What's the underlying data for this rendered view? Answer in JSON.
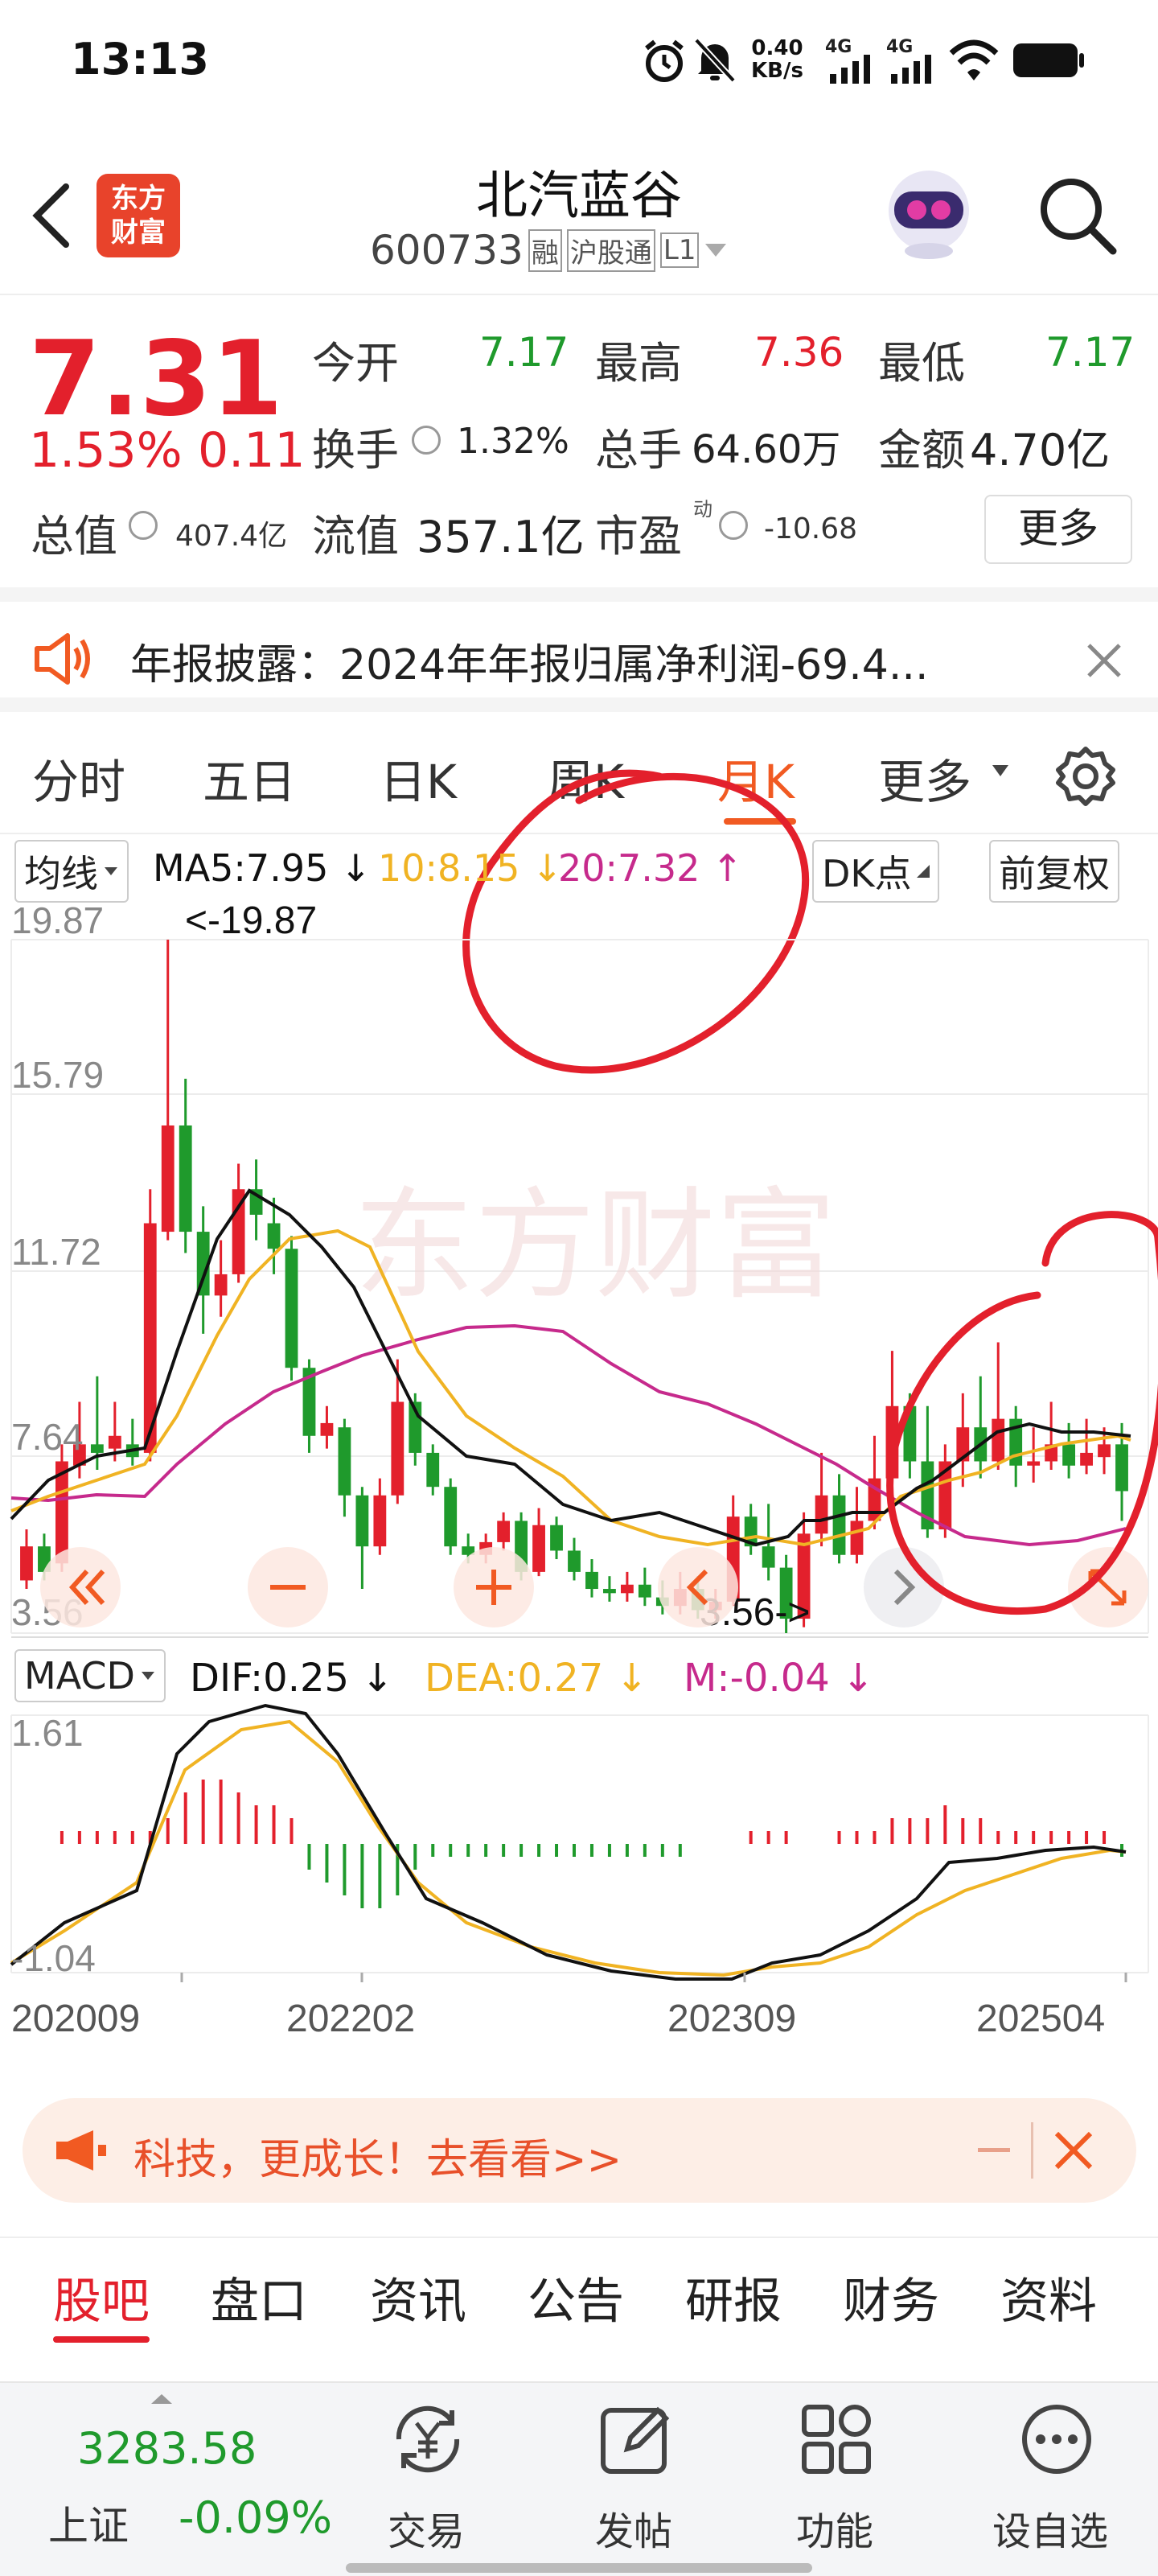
{
  "status_bar": {
    "time": "13:13",
    "net_speed_value": "0.40",
    "net_speed_unit": "KB/s",
    "signal1": "4G",
    "signal2": "4G"
  },
  "header": {
    "app_logo_line1": "东方",
    "app_logo_line2": "财富",
    "stock_name": "北汽蓝谷",
    "stock_code": "600733",
    "tag_margin": "融",
    "tag_connect": "沪股通",
    "tag_level": "L1"
  },
  "quote": {
    "price": "7.31",
    "change_pct": "1.53%",
    "change_abs": "0.11",
    "open_label": "今开",
    "open_value": "7.17",
    "high_label": "最高",
    "high_value": "7.36",
    "low_label": "最低",
    "low_value": "7.17",
    "turnover_label": "换手",
    "turnover_value": "1.32%",
    "volume_label": "总手",
    "volume_value": "64.60万",
    "amount_label": "金额",
    "amount_value": "4.70亿",
    "mktcap_label": "总值",
    "mktcap_value": "407.4亿",
    "float_label": "流值",
    "float_value": "357.1亿",
    "pe_label": "市盈",
    "pe_sup": "动",
    "pe_value": "-10.68",
    "more_button": "更多"
  },
  "notice": {
    "text": "年报披露：2024年年报归属净利润-69.4..."
  },
  "period_tabs": [
    {
      "label": "分时"
    },
    {
      "label": "五日"
    },
    {
      "label": "日K"
    },
    {
      "label": "周K"
    },
    {
      "label": "月K"
    },
    {
      "label": "更多"
    }
  ],
  "ma_bar": {
    "ma_selector": "均线",
    "ma5": "MA5:7.95 ↓",
    "ma10": "10:8.15 ↓",
    "ma20": "20:7.32 ↑",
    "dk_button": "DK点",
    "adjust_button": "前复权"
  },
  "colors": {
    "up": "#e3202c",
    "down": "#1f9a2c",
    "ma5": "#111111",
    "ma10": "#f0b323",
    "ma20": "#c62a8c",
    "accent": "#f15a22"
  },
  "kline": {
    "price_labels": [
      "19.87",
      "15.79",
      "11.72",
      "7.64",
      "3.56"
    ],
    "max_marker": "<-19.87",
    "min_marker": "3.56->",
    "watermark": "东方财富"
  },
  "chart_data": {
    "type": "candlestick",
    "ylim": [
      3.56,
      19.87
    ],
    "candles": [
      {
        "o": 4.8,
        "c": 5.6,
        "h": 6.0,
        "l": 4.6
      },
      {
        "o": 5.6,
        "c": 5.0,
        "h": 5.9,
        "l": 4.8
      },
      {
        "o": 5.2,
        "c": 7.6,
        "h": 8.0,
        "l": 5.0
      },
      {
        "o": 7.5,
        "c": 8.0,
        "h": 9.0,
        "l": 7.2
      },
      {
        "o": 8.0,
        "c": 7.8,
        "h": 9.6,
        "l": 7.4
      },
      {
        "o": 7.9,
        "c": 8.2,
        "h": 9.0,
        "l": 7.6
      },
      {
        "o": 8.0,
        "c": 7.7,
        "h": 8.6,
        "l": 7.5
      },
      {
        "o": 7.8,
        "c": 13.2,
        "h": 14.0,
        "l": 7.6
      },
      {
        "o": 13.0,
        "c": 15.5,
        "h": 19.87,
        "l": 12.8
      },
      {
        "o": 15.5,
        "c": 13.0,
        "h": 16.6,
        "l": 12.5
      },
      {
        "o": 13.0,
        "c": 11.5,
        "h": 13.6,
        "l": 10.6
      },
      {
        "o": 11.5,
        "c": 12.0,
        "h": 12.8,
        "l": 11.0
      },
      {
        "o": 12.0,
        "c": 14.0,
        "h": 14.6,
        "l": 11.8
      },
      {
        "o": 14.0,
        "c": 13.4,
        "h": 14.7,
        "l": 12.8
      },
      {
        "o": 13.2,
        "c": 12.6,
        "h": 13.8,
        "l": 12.0
      },
      {
        "o": 12.6,
        "c": 9.8,
        "h": 12.9,
        "l": 9.5
      },
      {
        "o": 9.8,
        "c": 8.2,
        "h": 10.0,
        "l": 7.8
      },
      {
        "o": 8.2,
        "c": 8.5,
        "h": 8.9,
        "l": 7.9
      },
      {
        "o": 8.4,
        "c": 6.8,
        "h": 8.6,
        "l": 6.3
      },
      {
        "o": 6.8,
        "c": 5.6,
        "h": 7.0,
        "l": 4.6
      },
      {
        "o": 5.6,
        "c": 6.8,
        "h": 7.2,
        "l": 5.4
      },
      {
        "o": 6.8,
        "c": 9.0,
        "h": 10.0,
        "l": 6.6
      },
      {
        "o": 9.0,
        "c": 7.8,
        "h": 9.2,
        "l": 7.5
      },
      {
        "o": 7.8,
        "c": 7.0,
        "h": 8.0,
        "l": 6.8
      },
      {
        "o": 7.0,
        "c": 5.6,
        "h": 7.2,
        "l": 5.4
      },
      {
        "o": 5.6,
        "c": 5.4,
        "h": 5.9,
        "l": 5.2
      },
      {
        "o": 5.4,
        "c": 5.7,
        "h": 5.9,
        "l": 5.2
      },
      {
        "o": 5.7,
        "c": 6.2,
        "h": 6.4,
        "l": 5.5
      },
      {
        "o": 6.2,
        "c": 5.0,
        "h": 6.4,
        "l": 4.8
      },
      {
        "o": 5.0,
        "c": 6.1,
        "h": 6.5,
        "l": 4.9
      },
      {
        "o": 6.1,
        "c": 5.5,
        "h": 6.3,
        "l": 5.3
      },
      {
        "o": 5.5,
        "c": 5.0,
        "h": 5.8,
        "l": 4.8
      },
      {
        "o": 5.0,
        "c": 4.6,
        "h": 5.3,
        "l": 4.4
      },
      {
        "o": 4.6,
        "c": 4.5,
        "h": 4.9,
        "l": 4.3
      },
      {
        "o": 4.5,
        "c": 4.7,
        "h": 5.0,
        "l": 4.3
      },
      {
        "o": 4.7,
        "c": 4.4,
        "h": 5.1,
        "l": 4.2
      },
      {
        "o": 4.4,
        "c": 4.2,
        "h": 4.8,
        "l": 4.0
      },
      {
        "o": 4.2,
        "c": 4.6,
        "h": 5.0,
        "l": 4.0
      },
      {
        "o": 4.6,
        "c": 4.1,
        "h": 4.9,
        "l": 3.9
      },
      {
        "o": 4.1,
        "c": 4.3,
        "h": 4.6,
        "l": 3.9
      },
      {
        "o": 4.3,
        "c": 6.3,
        "h": 6.8,
        "l": 4.2
      },
      {
        "o": 6.3,
        "c": 5.6,
        "h": 6.6,
        "l": 5.4
      },
      {
        "o": 5.6,
        "c": 5.1,
        "h": 6.6,
        "l": 4.8
      },
      {
        "o": 5.1,
        "c": 3.9,
        "h": 5.4,
        "l": 3.56
      },
      {
        "o": 3.9,
        "c": 5.9,
        "h": 6.4,
        "l": 3.7
      },
      {
        "o": 5.9,
        "c": 6.8,
        "h": 7.8,
        "l": 5.6
      },
      {
        "o": 6.8,
        "c": 5.4,
        "h": 7.3,
        "l": 5.2
      },
      {
        "o": 5.4,
        "c": 6.2,
        "h": 7.0,
        "l": 5.2
      },
      {
        "o": 6.2,
        "c": 7.2,
        "h": 8.2,
        "l": 6.0
      },
      {
        "o": 7.2,
        "c": 8.9,
        "h": 10.2,
        "l": 7.0
      },
      {
        "o": 8.9,
        "c": 7.6,
        "h": 9.2,
        "l": 7.2
      },
      {
        "o": 7.6,
        "c": 6.0,
        "h": 8.9,
        "l": 5.8
      },
      {
        "o": 6.0,
        "c": 7.6,
        "h": 8.0,
        "l": 5.8
      },
      {
        "o": 7.6,
        "c": 8.4,
        "h": 9.2,
        "l": 7.0
      },
      {
        "o": 8.4,
        "c": 7.6,
        "h": 9.6,
        "l": 7.2
      },
      {
        "o": 7.6,
        "c": 8.6,
        "h": 10.4,
        "l": 7.4
      },
      {
        "o": 8.6,
        "c": 7.5,
        "h": 8.9,
        "l": 7.0
      },
      {
        "o": 7.5,
        "c": 7.6,
        "h": 8.4,
        "l": 7.1
      },
      {
        "o": 7.6,
        "c": 8.0,
        "h": 9.0,
        "l": 7.4
      },
      {
        "o": 8.0,
        "c": 7.5,
        "h": 8.5,
        "l": 7.2
      },
      {
        "o": 7.5,
        "c": 7.8,
        "h": 8.6,
        "l": 7.3
      },
      {
        "o": 7.7,
        "c": 8.0,
        "h": 8.4,
        "l": 7.3
      },
      {
        "o": 8.0,
        "c": 6.9,
        "h": 8.5,
        "l": 6.2
      }
    ]
  },
  "macd": {
    "selector": "MACD",
    "dif": "DIF:0.25 ↓",
    "dea": "DEA:0.27 ↓",
    "m": "M:-0.04 ↓",
    "top_label": "1.61",
    "bottom_label": "-1.04",
    "x_labels": [
      "202009",
      "202202",
      "202309",
      "202504"
    ]
  },
  "banner": {
    "text": "科技，更成长！去看看>>"
  },
  "bottom_tabs": [
    {
      "label": "股吧"
    },
    {
      "label": "盘口"
    },
    {
      "label": "资讯"
    },
    {
      "label": "公告"
    },
    {
      "label": "研报"
    },
    {
      "label": "财务"
    },
    {
      "label": "资料"
    }
  ],
  "footer": {
    "index_value": "3283.58",
    "index_name": "上证",
    "index_change": "-0.09%",
    "trade": "交易",
    "post": "发帖",
    "function": "功能",
    "watchlist": "设自选"
  }
}
